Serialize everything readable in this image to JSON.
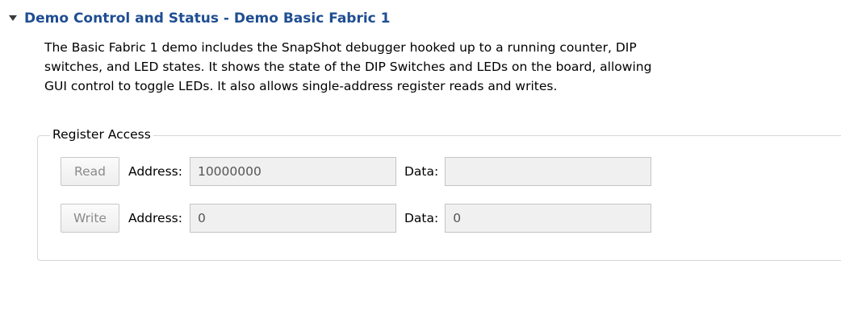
{
  "section": {
    "title": "Demo Control and Status - Demo Basic Fabric 1",
    "expanded": true,
    "title_color": "#1f4e92",
    "description_lines": [
      "The Basic Fabric 1 demo includes the SnapShot debugger hooked up to a running counter, DIP",
      "switches, and LED states.  It shows the state of the DIP Switches and LEDs on the board, allowing",
      "GUI control to toggle LEDs.  It also allows single-address register reads and writes."
    ]
  },
  "register_access": {
    "legend": "Register Access",
    "rows": [
      {
        "button_label": "Read",
        "address_label": "Address:",
        "address_value": "10000000",
        "data_label": "Data:",
        "data_value": ""
      },
      {
        "button_label": "Write",
        "address_label": "Address:",
        "address_value": "0",
        "data_label": "Data:",
        "data_value": "0"
      }
    ]
  },
  "icons": {
    "twisty": "triangle-down-icon"
  }
}
